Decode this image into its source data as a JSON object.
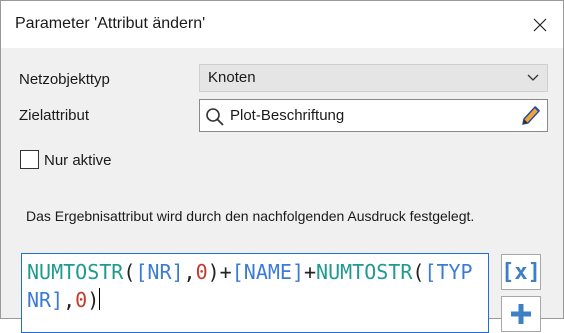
{
  "window": {
    "title": "Parameter 'Attribut ändern'",
    "close_icon": "close-icon"
  },
  "form": {
    "netzobjekttyp_label": "Netzobjekttyp",
    "netzobjekttyp_value": "Knoten",
    "zielattribut_label": "Zielattribut",
    "zielattribut_value": "Plot-Beschriftung",
    "nur_aktive_label": "Nur aktive",
    "nur_aktive_checked": false
  },
  "description": "Das Ergebnisattribut wird durch den nachfolgenden Ausdruck festgelegt.",
  "expression": {
    "tokens": [
      {
        "text": "NUMTOSTR",
        "kind": "fn"
      },
      {
        "text": "(",
        "kind": "pl"
      },
      {
        "text": "[NR]",
        "kind": "at"
      },
      {
        "text": ",",
        "kind": "pl"
      },
      {
        "text": "0",
        "kind": "nm"
      },
      {
        "text": ")+",
        "kind": "pl"
      },
      {
        "text": "[NAME]",
        "kind": "at"
      },
      {
        "text": "+",
        "kind": "pl"
      },
      {
        "text": "NUMTOSTR",
        "kind": "fn"
      },
      {
        "text": "(",
        "kind": "pl"
      },
      {
        "text": "[TYPNR]",
        "kind": "at"
      },
      {
        "text": ",",
        "kind": "pl"
      },
      {
        "text": "0",
        "kind": "nm"
      },
      {
        "text": ")",
        "kind": "pl"
      }
    ]
  },
  "side_buttons": {
    "insert_attribute_label": "[x]",
    "add_icon": "plus-icon"
  },
  "colors": {
    "function": "#1f9a8e",
    "attribute": "#3b7bd6",
    "number": "#c23b2e",
    "focus_border": "#1f6fd6"
  }
}
